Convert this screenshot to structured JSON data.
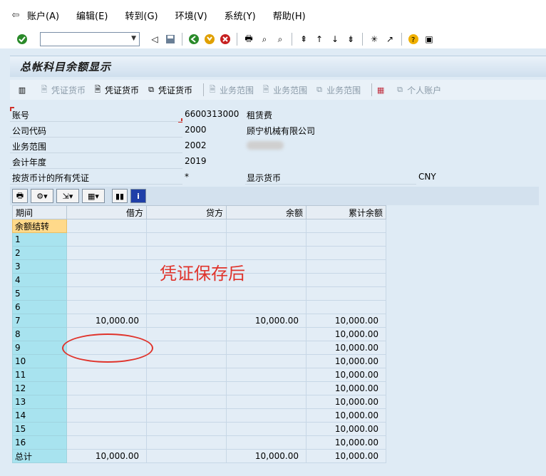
{
  "menu": {
    "items": [
      "账户(A)",
      "编辑(E)",
      "转到(G)",
      "环境(V)",
      "系统(Y)",
      "帮助(H)"
    ]
  },
  "window": {
    "title": "总帐科目余额显示"
  },
  "app_toolbar": {
    "buttons": [
      {
        "label": "凭证货币",
        "enabled": false
      },
      {
        "label": "凭证货币",
        "enabled": true
      },
      {
        "label": "凭证货币",
        "enabled": true
      },
      {
        "label": "业务范围",
        "enabled": false
      },
      {
        "label": "业务范围",
        "enabled": false
      },
      {
        "label": "业务范围",
        "enabled": false
      },
      {
        "label": "个人账户",
        "enabled": false
      }
    ]
  },
  "header": {
    "account_label": "账号",
    "account_value": "6600313000",
    "account_desc": "租赁费",
    "company_label": "公司代码",
    "company_value": "2000",
    "company_desc": "顾宁机械有限公司",
    "business_area_label": "业务范围",
    "business_area_value": "2002",
    "fiscal_year_label": "会计年度",
    "fiscal_year_value": "2019",
    "all_docs_label": "按货币计的所有凭证",
    "all_docs_value": "*",
    "display_currency_label": "显示货币",
    "display_currency_value": "CNY"
  },
  "table": {
    "columns": [
      "期间",
      "借方",
      "贷方",
      "余额",
      "累计余额"
    ],
    "rows": [
      [
        "余额结转",
        "",
        "",
        "",
        ""
      ],
      [
        "1",
        "",
        "",
        "",
        ""
      ],
      [
        "2",
        "",
        "",
        "",
        ""
      ],
      [
        "3",
        "",
        "",
        "",
        ""
      ],
      [
        "4",
        "",
        "",
        "",
        ""
      ],
      [
        "5",
        "",
        "",
        "",
        ""
      ],
      [
        "6",
        "",
        "",
        "",
        ""
      ],
      [
        "7",
        "10,000.00",
        "",
        "10,000.00",
        "10,000.00"
      ],
      [
        "8",
        "",
        "",
        "",
        "10,000.00"
      ],
      [
        "9",
        "",
        "",
        "",
        "10,000.00"
      ],
      [
        "10",
        "",
        "",
        "",
        "10,000.00"
      ],
      [
        "11",
        "",
        "",
        "",
        "10,000.00"
      ],
      [
        "12",
        "",
        "",
        "",
        "10,000.00"
      ],
      [
        "13",
        "",
        "",
        "",
        "10,000.00"
      ],
      [
        "14",
        "",
        "",
        "",
        "10,000.00"
      ],
      [
        "15",
        "",
        "",
        "",
        "10,000.00"
      ],
      [
        "16",
        "",
        "",
        "",
        "10,000.00"
      ],
      [
        "总计",
        "10,000.00",
        "",
        "10,000.00",
        "10,000.00"
      ]
    ]
  },
  "annotation": {
    "text": "凭证保存后",
    "color": "#e0332b"
  },
  "colors": {
    "period_cell": "#a8e3ef",
    "selected_period": "#ffd98a",
    "background": "#dfebf5"
  }
}
